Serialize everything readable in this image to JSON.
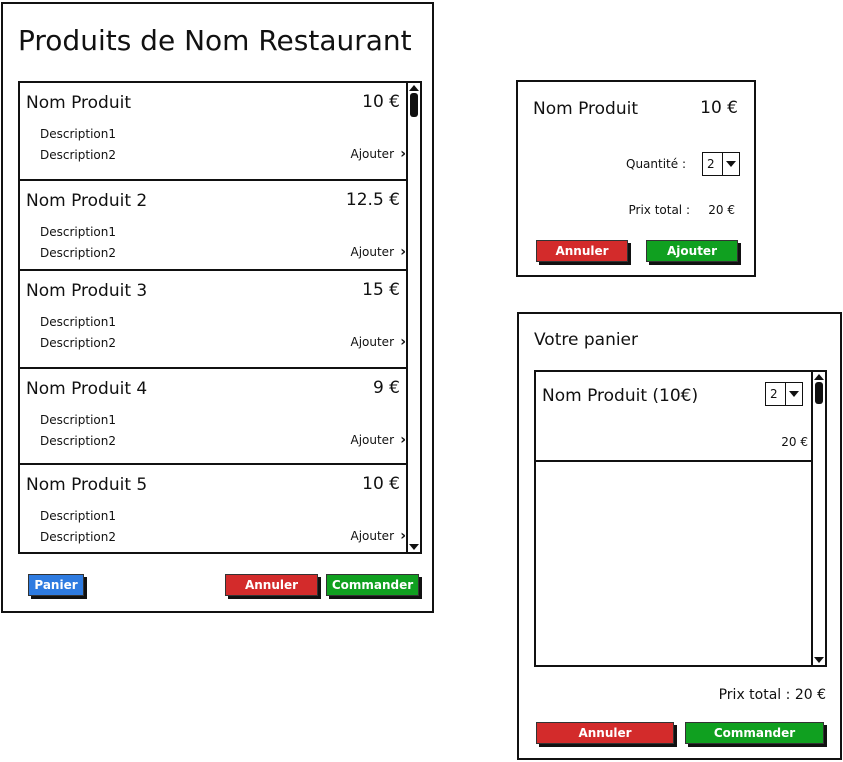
{
  "main": {
    "title": "Produits de Nom Restaurant",
    "products": [
      {
        "name": "Nom Produit",
        "price": "10 €",
        "desc1": "Description1",
        "desc2": "Description2",
        "add_label": "Ajouter"
      },
      {
        "name": "Nom Produit 2",
        "price": "12.5 €",
        "desc1": "Description1",
        "desc2": "Description2",
        "add_label": "Ajouter"
      },
      {
        "name": "Nom Produit 3",
        "price": "15 €",
        "desc1": "Description1",
        "desc2": "Description2",
        "add_label": "Ajouter"
      },
      {
        "name": "Nom Produit 4",
        "price": "9 €",
        "desc1": "Description1",
        "desc2": "Description2",
        "add_label": "Ajouter"
      },
      {
        "name": "Nom Produit 5",
        "price": "10 €",
        "desc1": "Description1",
        "desc2": "Description2",
        "add_label": "Ajouter"
      }
    ],
    "buttons": {
      "cart": "Panier",
      "cancel": "Annuler",
      "order": "Commander"
    }
  },
  "detail": {
    "name": "Nom Produit",
    "price": "10 €",
    "quantity_label": "Quantité :",
    "quantity_value": "2",
    "total_label": "Prix total :",
    "total_value": "20 €",
    "buttons": {
      "cancel": "Annuler",
      "add": "Ajouter"
    }
  },
  "cart": {
    "title": "Votre panier",
    "items": [
      {
        "name": "Nom Produit (10€)",
        "quantity": "2",
        "subtotal": "20 €"
      }
    ],
    "total_label": "Prix total : 20 €",
    "buttons": {
      "cancel": "Annuler",
      "order": "Commander"
    }
  },
  "colors": {
    "blue_button": "#2e7be0",
    "red_button": "#d32b2b",
    "green_button": "#10a020",
    "border": "#111111"
  }
}
